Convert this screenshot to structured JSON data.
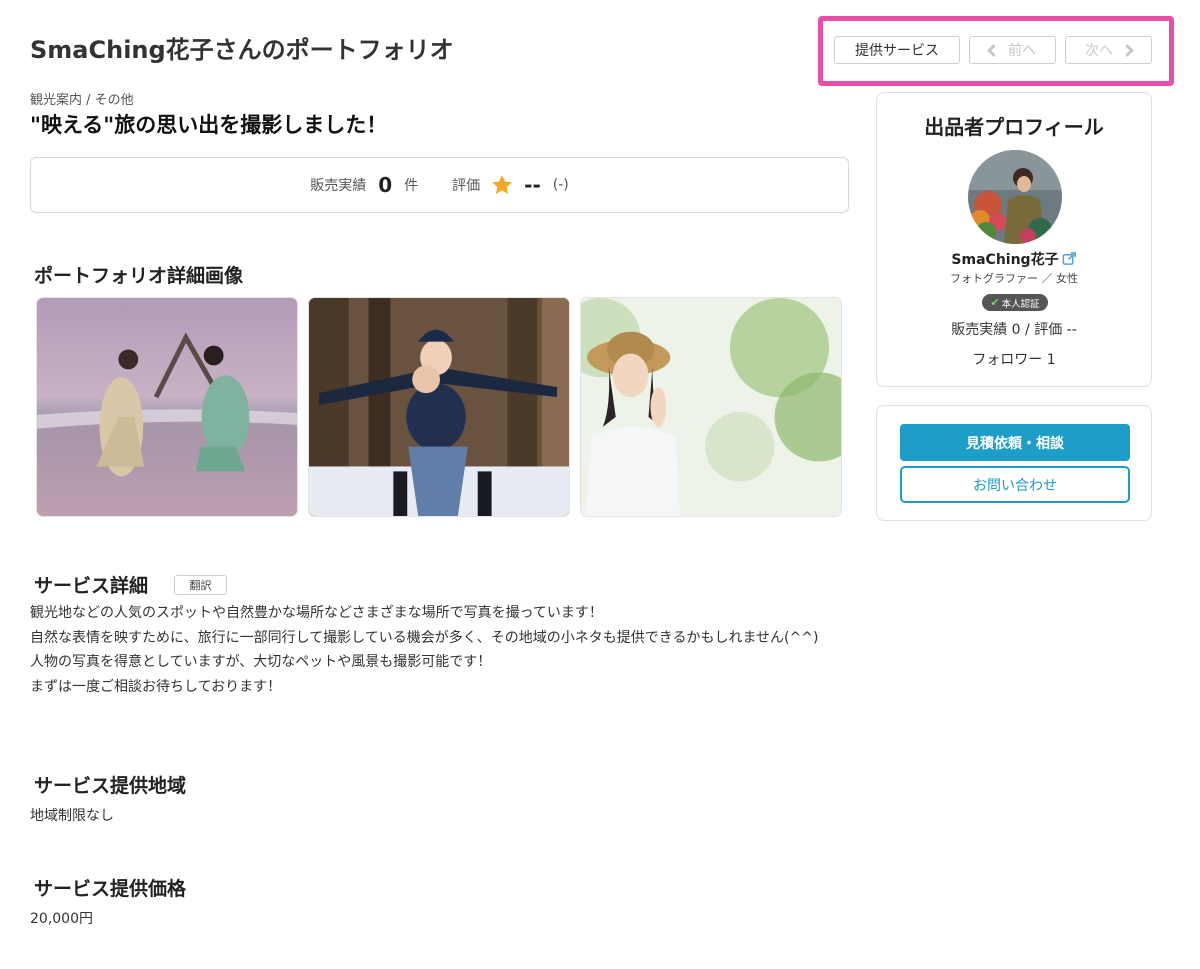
{
  "header": {
    "title": "SmaChing花子さんのポートフォリオ",
    "nav": {
      "services_label": "提供サービス",
      "prev_label": "前へ",
      "next_label": "次へ"
    }
  },
  "portfolio": {
    "breadcrumb": "観光案内 / その他",
    "title": "\"映える\"旅の思い出を撮影しました！",
    "stats": {
      "sales_label": "販売実績",
      "sales_count": "0",
      "sales_unit": "件",
      "rating_label": "評価",
      "rating_value": "--",
      "rating_count": "(-)"
    }
  },
  "images_section": {
    "heading": "ポートフォリオ詳細画像"
  },
  "service_detail": {
    "heading": "サービス詳細",
    "translate_label": "翻訳",
    "lines": [
      "観光地などの人気のスポットや自然豊かな場所などさまざまな場所で写真を撮っています！",
      "自然な表情を映すために、旅行に一部同行して撮影している機会が多く、その地域の小ネタも提供できるかもしれません(^^)",
      "人物の写真を得意としていますが、大切なペットや風景も撮影可能です！",
      "まずは一度ご相談お待ちしております！"
    ]
  },
  "service_area": {
    "heading": "サービス提供地域",
    "value": "地域制限なし"
  },
  "service_price": {
    "heading": "サービス提供価格",
    "value": "20,000円"
  },
  "profile": {
    "title": "出品者プロフィール",
    "name": "SmaChing花子",
    "job": "フォトグラファー ／ 女性",
    "verified_label": "本人認証",
    "stats": "販売実績 0 / 評価 --",
    "followers": "フォロワー 1"
  },
  "actions": {
    "quote_label": "見積依頼・相談",
    "inquiry_label": "お問い合わせ"
  },
  "colors": {
    "accent": "#1e9dc8",
    "highlight": "#e84fa6",
    "star": "#f5a623"
  }
}
